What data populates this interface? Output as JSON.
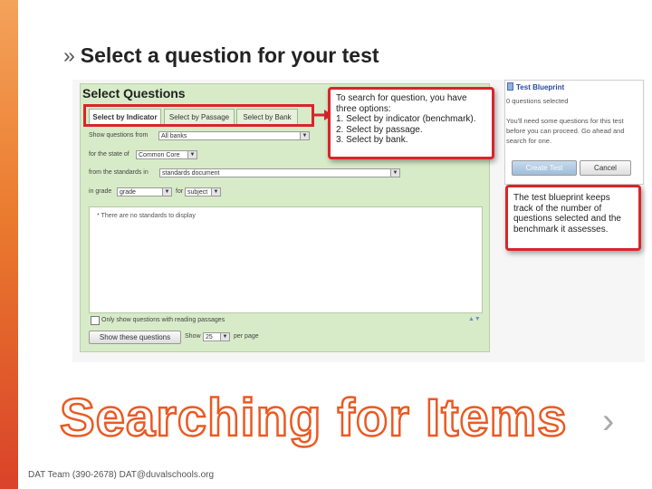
{
  "slide": {
    "heading": "Select a question for your test",
    "heading_bullet": "»",
    "big_title": "Searching for Items",
    "footer": "DAT Team (390-2678) DAT@duvalschools.org",
    "next_glyph": "›",
    "accent_color": "#ea5a23",
    "callout_border_color": "#d9252a"
  },
  "select_panel": {
    "title": "Select Questions",
    "tabs": [
      "Select by Indicator",
      "Select by Passage",
      "Select by Bank"
    ],
    "active_tab": "Select by Indicator",
    "show_from_label": "Show questions from",
    "show_from_value": "All banks",
    "state_label": "for the state of",
    "state_value": "Common Core",
    "standards_label": "from the standards in",
    "standards_value": "standards document",
    "grade_label": "in grade",
    "grade_value": "grade",
    "for_label": "for",
    "subject_value": "subject",
    "results_empty_text": "* There are no standards to display",
    "checkbox_label": "Only show questions with reading passages",
    "show_button": "Show these questions",
    "show_label": "Show",
    "per_page_value": "25",
    "per_page_label": "per page"
  },
  "callout_options": {
    "lines": [
      "To search for question, you have",
      "three options:",
      "1. Select by indicator (benchmark).",
      "2. Select by passage.",
      "3. Select by bank."
    ]
  },
  "blueprint": {
    "title": "Test Blueprint",
    "count_text": "0 questions selected",
    "message_lines": [
      "You'll need some questions for this test",
      "before you can proceed. Go ahead and",
      "search for one."
    ],
    "create_button": "Create Test",
    "cancel_button": "Cancel"
  },
  "callout_blueprint": {
    "lines": [
      "The test blueprint keeps",
      "track of the number of",
      "questions selected and the",
      "benchmark it assesses."
    ]
  }
}
